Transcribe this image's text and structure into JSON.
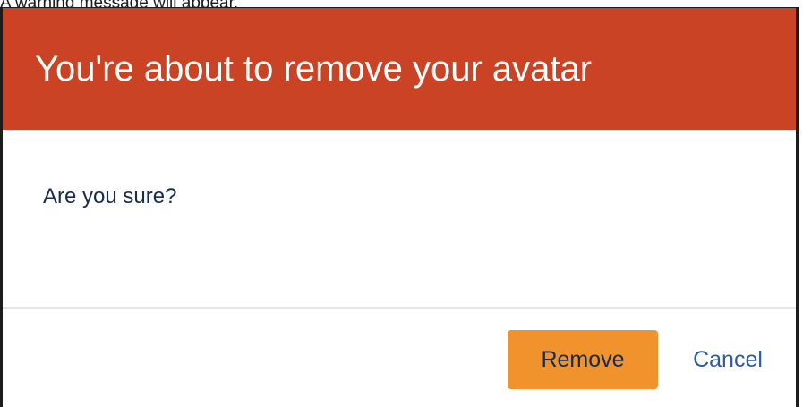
{
  "caption": "A warning message will appear.",
  "dialog": {
    "title": "You're about to remove your avatar",
    "message": "Are you sure?",
    "buttons": {
      "remove_label": "Remove",
      "cancel_label": "Cancel"
    }
  },
  "colors": {
    "header_background": "#c94324",
    "primary_button": "#f0932c",
    "link": "#2c5aa0",
    "body_text": "#172b4d"
  }
}
